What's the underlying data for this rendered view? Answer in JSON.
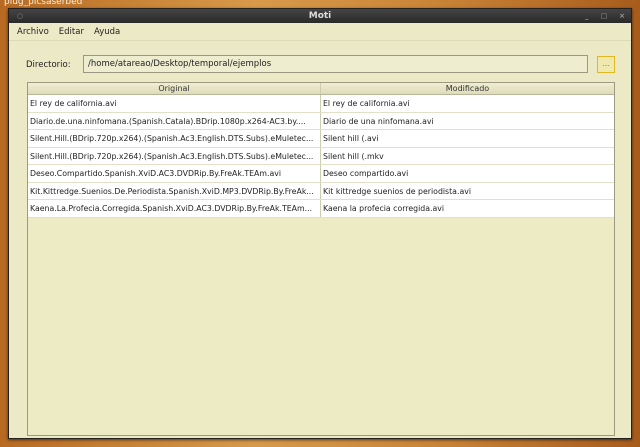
{
  "desktop": {
    "label": "plug_picsaserbed"
  },
  "window": {
    "title": "Moti"
  },
  "menu": [
    "Archivo",
    "Editar",
    "Ayuda"
  ],
  "directory": {
    "label": "Directorio:",
    "value": "/home/atareao/Desktop/temporal/ejemplos",
    "browse_label": "..."
  },
  "table": {
    "headers": [
      "Original",
      "Modificado"
    ],
    "rows": [
      [
        "El rey de california.avi",
        "El rey de california.avi"
      ],
      [
        "Diario.de.una.ninfomana.(Spanish.Catala).BDrip.1080p.x264-AC3.by....",
        "Diario de una ninfomana.avi"
      ],
      [
        "Silent.Hill.(BDrip.720p.x264).(Spanish.Ac3.English.DTS.Subs).eMuletec...",
        "Silent hill (.avi"
      ],
      [
        "Silent.Hill.(BDrip.720p.x264).(Spanish.Ac3.English.DTS.Subs).eMuletec...",
        "Silent hill (.mkv"
      ],
      [
        "Deseo.Compartido.Spanish.XviD.AC3.DVDRip.By.FreAk.TEAm.avi",
        "Deseo compartido.avi"
      ],
      [
        "Kit.Kittredge.Suenios.De.Periodista.Spanish.XviD.MP3.DVDRip.By.FreAk...",
        "Kit kittredge suenios de periodista.avi"
      ],
      [
        "Kaena.La.Profecia.Corregida.Spanish.XviD.AC3.DVDRip.By.FreAk.TEAm...",
        "Kaena la profecia corregida.avi"
      ]
    ]
  }
}
